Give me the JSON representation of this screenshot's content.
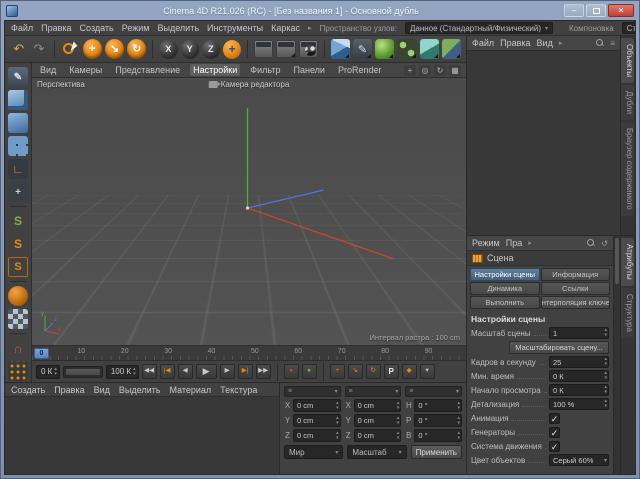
{
  "window": {
    "title": "Cinema 4D R21.026 (RC) - [Без названия 1] - Основной дубль"
  },
  "titlebar_icons": {
    "minimize": "–",
    "close": "✕"
  },
  "menubar": {
    "items": [
      "Файл",
      "Правка",
      "Создать",
      "Режим",
      "Выделить",
      "Инструменты",
      "Каркас"
    ],
    "overflow": "▸",
    "node_space_label": "Пространство узлов:",
    "node_space_value": "Данное (Стандартный/Физический)",
    "layout_label": "Компоновка",
    "layout_value": "Стартовая"
  },
  "toolbar": {
    "tools": [
      "undo",
      "redo",
      "live-selection",
      "move",
      "scale",
      "rotate",
      "axis-x",
      "axis-y",
      "axis-z",
      "coordinate-system",
      "render-view",
      "render-to-picture-viewer",
      "edit-render-settings",
      "add-cube",
      "pen-spline",
      "subdivision-surface",
      "array-instance",
      "volume-builder",
      "field"
    ],
    "undo": "↶",
    "redo": "↷",
    "move": "+",
    "scale": "↘",
    "rotate": "↻",
    "coord": "+",
    "x": "X",
    "y": "Y",
    "z": "Z",
    "pen": "✎"
  },
  "palette": {
    "tools": [
      "make-editable",
      "model-mode",
      "object-mode",
      "array-mode",
      "workplane",
      "axis-modification",
      "solo-off",
      "solo-single",
      "solo-hierarchy",
      "simulate",
      "texture-mode",
      "snap",
      "quantize"
    ],
    "solo": "S",
    "workplane": "∟",
    "axis": "+",
    "magnet": "∩",
    "pen": "✎"
  },
  "viewport": {
    "menu": [
      "Вид",
      "Камеры",
      "Представление",
      "Настройки",
      "Фильтр",
      "Панели",
      "ProRender"
    ],
    "active_menu": "Настройки",
    "icons": {
      "pan": "+",
      "zoom": "◎",
      "rotate": "↻",
      "maximize": "▦"
    },
    "view_label": "Перспектива",
    "camera_label": "Камера редактора",
    "grid_label": "Интервал растра : 100 cm",
    "axis_x": "x",
    "axis_y": "y",
    "axis_z": "z"
  },
  "timeline": {
    "ticks": [
      "0",
      "10",
      "20",
      "30",
      "40",
      "50",
      "60",
      "70",
      "80",
      "90"
    ],
    "current_frame": "0",
    "range_start": "0 К",
    "range_end": "100 К"
  },
  "animbar": {
    "go_start": "◀◀",
    "prev_key": "|◀",
    "prev_frame": "◀",
    "play": "▶",
    "next_frame": "▶",
    "next_key": "▶|",
    "go_end": "▶▶",
    "record": "●",
    "autokey": "●",
    "key_pos": "+",
    "key_scale": "↘",
    "key_rot": "↻",
    "key_param": "P",
    "key_pla": "◆",
    "dropdown": "▾",
    "stepper_up": "▴",
    "stepper_down": "▾",
    "header": "≡"
  },
  "materials": {
    "menu": [
      "Создать",
      "Правка",
      "Вид",
      "Выделить",
      "Материал",
      "Текстура"
    ]
  },
  "coords": {
    "labels": {
      "x": "X",
      "y": "Y",
      "z": "Z",
      "h": "H",
      "p": "P",
      "b": "B"
    },
    "pos": {
      "x": "0 cm",
      "y": "0 cm",
      "z": "0 cm"
    },
    "size": {
      "x": "0 cm",
      "y": "0 cm",
      "z": "0 cm"
    },
    "rot": {
      "h": "0 °",
      "p": "0 °",
      "b": "0 °"
    },
    "world": "Мир",
    "scale_mode": "Масштаб",
    "apply": "Применить"
  },
  "objects_panel": {
    "menu": [
      "Файл",
      "Правка",
      "Вид"
    ],
    "overflow": "▸",
    "filter": "≡",
    "side_tabs": [
      "Объекты",
      "Дубли",
      "Браузер содержимого"
    ]
  },
  "attributes": {
    "menu": [
      "Режим",
      "Пра"
    ],
    "overflow": "▸",
    "history": "↺",
    "object_name": "Сцена",
    "tabs": [
      "Настройки сцены",
      "Информация",
      "Динамика",
      "Ссылки",
      "Выполнить",
      "Интерполяция ключей"
    ],
    "active_tab": "Настройки сцены",
    "section": "Настройки сцены",
    "scale_label": "Масштаб сцены",
    "scale_value": "1",
    "scale_button": "Масштабировать сцену...",
    "fps_label": "Кадров в секунду",
    "fps_value": "25",
    "min_time_label": "Мин. время",
    "min_time_value": "0 К",
    "preview_start_label": "Начало просмотра",
    "preview_start_value": "0 К",
    "lod_label": "Детализация",
    "lod_value": "100 %",
    "animation_label": "Анимация",
    "generators_label": "Генераторы",
    "motion_label": "Система движения",
    "color_label": "Цвет объектов",
    "color_value": "Серый 60%",
    "check": "✓",
    "side_tabs": [
      "Атрибуты",
      "Структура"
    ]
  }
}
